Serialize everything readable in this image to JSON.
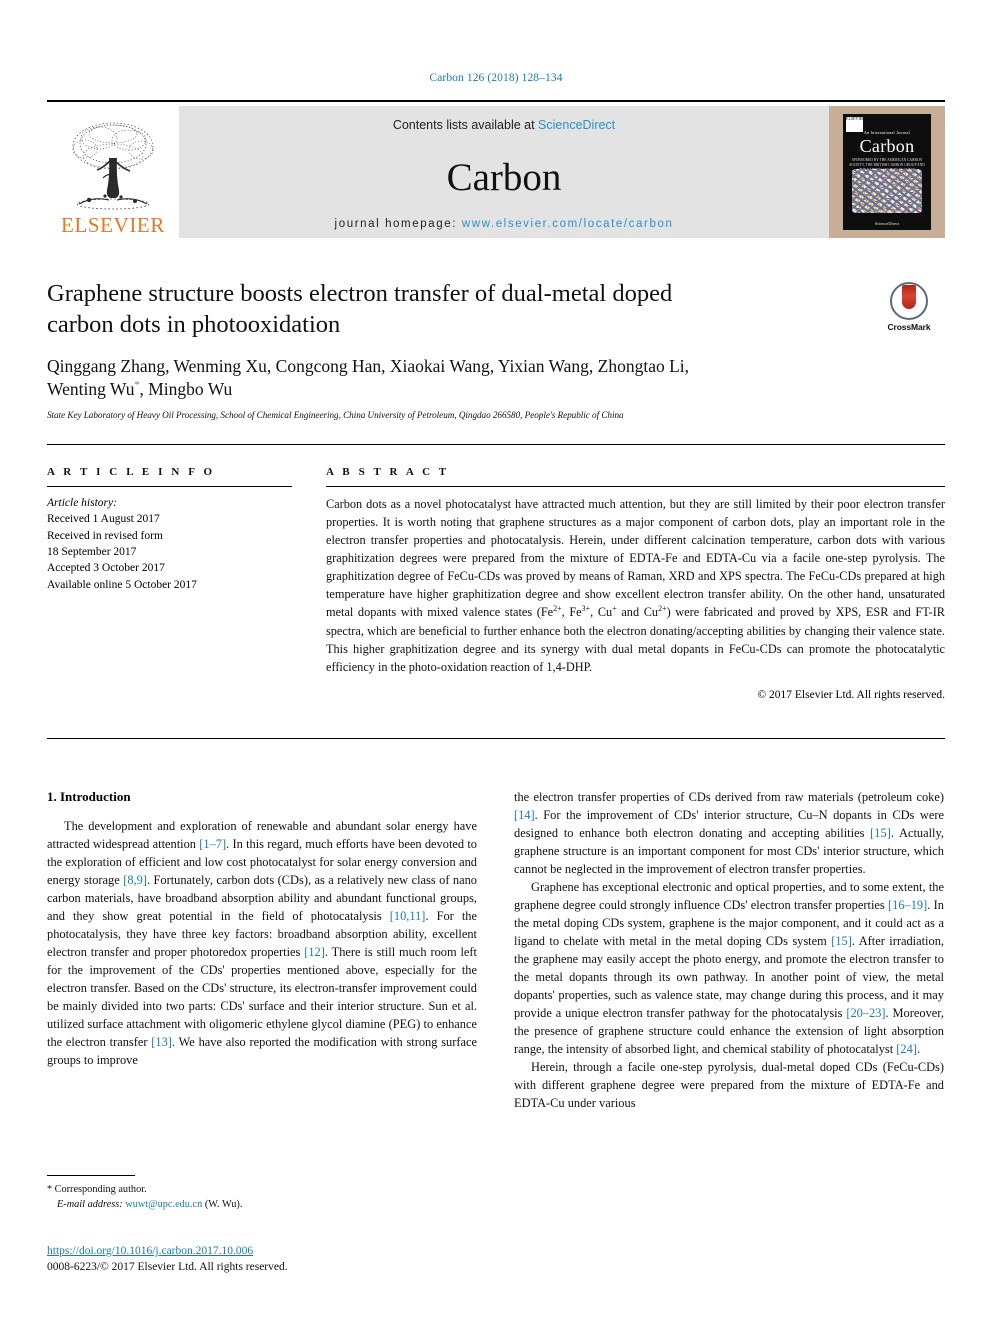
{
  "running_head": "Carbon 126 (2018) 128–134",
  "masthead": {
    "publisher_logo_label": "ELSEVIER",
    "contents_prefix": "Contents lists available at ",
    "contents_link": "ScienceDirect",
    "journal_name": "Carbon",
    "homepage_prefix": "journal homepage: ",
    "homepage_url": "www.elsevier.com/locate/carbon",
    "cover": {
      "badge_text": "ELSEVIER",
      "superline": "An International Journal",
      "title": "Carbon",
      "subtitle": "SPONSORED BY THE AMERICAN CARBON SOCIETY, THE BRITISH CARBON GROUP AND THE CARBON SOCIETY OF JAPAN",
      "volume_line": "VOLUME 126 2018",
      "footer_line": "Available online at www.sciencedirect.com",
      "publisher": "ScienceDirect"
    }
  },
  "article": {
    "title": "Graphene structure boosts electron transfer of dual-metal doped carbon dots in photooxidation",
    "crossmark_label": "CrossMark",
    "authors_line_1": "Qinggang Zhang, Wenming Xu, Congcong Han, Xiaokai Wang, Yixian Wang, Zhongtao Li,",
    "authors_line_2_pre": "Wenting Wu",
    "authors_star": "*",
    "authors_line_2_post": ", Mingbo Wu",
    "affiliation": "State Key Laboratory of Heavy Oil Processing, School of Chemical Engineering, China University of Petroleum, Qingdao 266580, People's Republic of China"
  },
  "article_info": {
    "heading": "A R T I C L E   I N F O",
    "history_label": "Article history:",
    "history": [
      "Received 1 August 2017",
      "Received in revised form",
      "18 September 2017",
      "Accepted 3 October 2017",
      "Available online 5 October 2017"
    ]
  },
  "abstract": {
    "heading": "A B S T R A C T",
    "text_part_1": "Carbon dots as a novel photocatalyst have attracted much attention, but they are still limited by their poor electron transfer properties. It is worth noting that graphene structures as a major component of carbon dots, play an important role in the electron transfer properties and photocatalysis. Herein, under different calcination temperature, carbon dots with various graphitization degrees were prepared from the mixture of EDTA-Fe and EDTA-Cu via a facile one-step pyrolysis. The graphitization degree of FeCu-CDs was proved by means of Raman, XRD and XPS spectra. The FeCu-CDs prepared at high temperature have higher graphitization degree and show excellent electron transfer ability. On the other hand, unsaturated metal dopants with mixed valence states (Fe",
    "sup_1": "2+",
    "text_part_2": ", Fe",
    "sup_2": "3+",
    "text_part_3": ", Cu",
    "sup_3": "+",
    "text_part_4": " and Cu",
    "sup_4": "2+",
    "text_part_5": ") were fabricated and proved by XPS, ESR and FT-IR spectra, which are beneficial to further enhance both the electron donating/accepting abilities by changing their valence state. This higher graphitization degree and its synergy with dual metal dopants in FeCu-CDs can promote the photocatalytic efficiency in the photo-oxidation reaction of 1,4-DHP.",
    "copyright": "© 2017 Elsevier Ltd. All rights reserved."
  },
  "introduction": {
    "heading": "1.  Introduction",
    "left_paragraph_1": {
      "t1": "The development and exploration of renewable and abundant solar energy have attracted widespread attention ",
      "r1": "[1–7]",
      "t2": ". In this regard, much efforts have been devoted to the exploration of efficient and low cost photocatalyst for solar energy conversion and energy storage ",
      "r2": "[8,9]",
      "t3": ". Fortunately, carbon dots (CDs), as a relatively new class of nano carbon materials, have broadband absorption ability and abundant functional groups, and they show great potential in the field of photocatalysis ",
      "r3": "[10,11]",
      "t4": ". For the photocatalysis, they have three key factors: broadband absorption ability, excellent electron transfer and proper photoredox properties ",
      "r4": "[12]",
      "t5": ". There is still much room left for the improvement of the CDs' properties mentioned above, especially for the electron transfer. Based on the CDs' structure, its electron-transfer improvement could be mainly divided into two parts: CDs' surface and their interior structure. Sun et al. utilized surface attachment with oligomeric ethylene glycol diamine (PEG) to enhance the electron transfer ",
      "r5": "[13]",
      "t6": ". We have also reported the modification with strong surface groups to improve"
    },
    "right_paragraph_1": {
      "t1": "the electron transfer properties of CDs derived from raw materials (petroleum coke) ",
      "r1": "[14]",
      "t2": ". For the improvement of CDs' interior structure, Cu–N dopants in CDs were designed to enhance both electron donating and accepting abilities ",
      "r2": "[15]",
      "t3": ". Actually, graphene structure is an important component for most CDs' interior structure, which cannot be neglected in the improvement of electron transfer properties."
    },
    "right_paragraph_2": {
      "t1": "Graphene has exceptional electronic and optical properties, and to some extent, the graphene degree could strongly influence CDs' electron transfer properties ",
      "r1": "[16–19]",
      "t2": ". In the metal doping CDs system, graphene is the major component, and it could act as a ligand to chelate with metal in the metal doping CDs system ",
      "r2": "[15]",
      "t3": ". After irradiation, the graphene may easily accept the photo energy, and promote the electron transfer to the metal dopants through its own pathway. In another point of view, the metal dopants' properties, such as valence state, may change during this process, and it may provide a unique electron transfer pathway for the photocatalysis ",
      "r3": "[20–23]",
      "t4": ". Moreover, the presence of graphene structure could enhance the extension of light absorption range, the intensity of absorbed light, and chemical stability of photocatalyst ",
      "r4": "[24]",
      "t5": "."
    },
    "right_paragraph_3": {
      "t1": "Herein, through a facile one-step pyrolysis, dual-metal doped CDs (FeCu-CDs) with different graphene degree were prepared from the mixture of EDTA-Fe and EDTA-Cu under various"
    }
  },
  "footer": {
    "corresponding_star": "*",
    "corresponding_label": " Corresponding author.",
    "email_label": "E-mail address:",
    "email": "wuwt@upc.edu.cn",
    "email_suffix": "(W. Wu).",
    "doi": "https://doi.org/10.1016/j.carbon.2017.10.006",
    "issn_line": "0008-6223/© 2017 Elsevier Ltd. All rights reserved."
  },
  "colors": {
    "link_blue": "#1a7bb0",
    "sciencedirect_blue": "#2a93c9",
    "elsevier_orange": "#E87722",
    "band_gray": "#e3e3e3"
  }
}
